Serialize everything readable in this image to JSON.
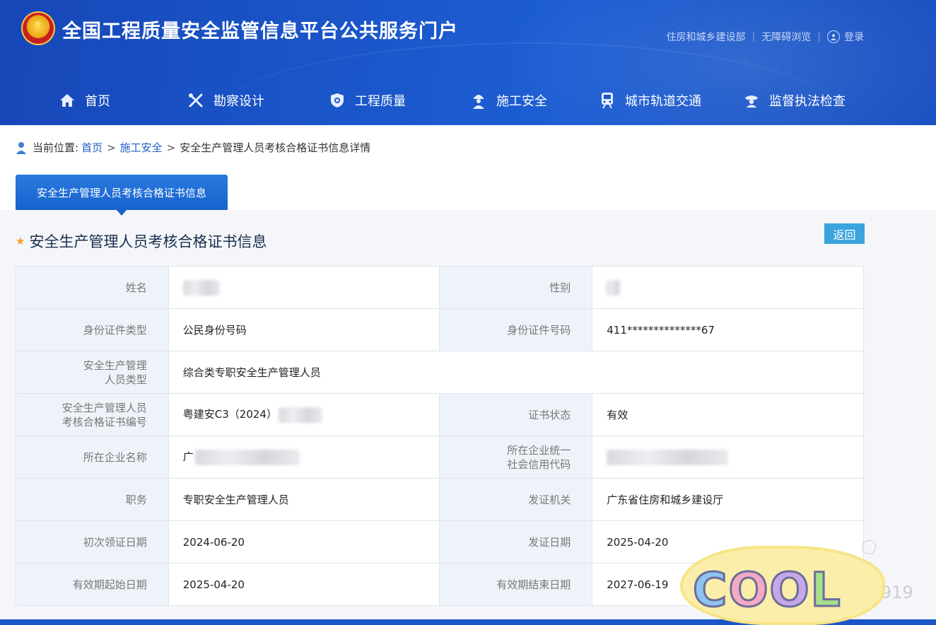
{
  "header": {
    "site_title": "全国工程质量安全监管信息平台公共服务门户",
    "links": [
      "住房和城乡建设部",
      "无障碍浏览"
    ],
    "login_label": "登录"
  },
  "nav": [
    {
      "label": "首页",
      "icon": "home-icon"
    },
    {
      "label": "勘察设计",
      "icon": "tools-icon"
    },
    {
      "label": "工程质量",
      "icon": "shield-icon"
    },
    {
      "label": "施工安全",
      "icon": "worker-icon"
    },
    {
      "label": "城市轨道交通",
      "icon": "train-icon"
    },
    {
      "label": "监督执法检查",
      "icon": "officer-icon"
    }
  ],
  "breadcrumb": {
    "prefix": "当前位置:",
    "home": "首页",
    "section": "施工安全",
    "current": "安全生产管理人员考核合格证书信息详情",
    "sep": ">"
  },
  "tab": {
    "label": "安全生产管理人员考核合格证书信息"
  },
  "section": {
    "title": "安全生产管理人员考核合格证书信息",
    "back_label": "返回"
  },
  "fields": {
    "name_label": "姓名",
    "gender_label": "性别",
    "id_type_label": "身份证件类型",
    "id_type_value": "公民身份号码",
    "id_no_label": "身份证件号码",
    "id_no_value": "411**************67",
    "person_type_label_1": "安全生产管理",
    "person_type_label_2": "人员类型",
    "person_type_value": "综合类专职安全生产管理人员",
    "cert_no_label_1": "安全生产管理人员",
    "cert_no_label_2": "考核合格证书编号",
    "cert_no_value": "粤建安C3（2024）",
    "status_label": "证书状态",
    "status_value": "有效",
    "company_label": "所在企业名称",
    "company_value": "广",
    "credit_code_label_1": "所在企业统一",
    "credit_code_label_2": "社会信用代码",
    "position_label": "职务",
    "position_value": "专职安全生产管理人员",
    "issuer_label": "发证机关",
    "issuer_value": "广东省住房和城乡建设厅",
    "first_issue_label": "初次领证日期",
    "first_issue_value": "2024-06-20",
    "issue_date_label": "发证日期",
    "issue_date_value": "2025-04-20",
    "valid_start_label": "有效期起始日期",
    "valid_start_value": "2025-04-20",
    "valid_end_label": "有效期结束日期",
    "valid_end_value": "2027-06-19"
  },
  "sticker": {
    "text": "COOL"
  },
  "watermark": {
    "digits": "919"
  },
  "colors": {
    "brand": "#1a55c8",
    "tab": "#1762cc",
    "back_button": "#3ba3df",
    "star": "#f0a020",
    "label_bg": "#eef3fa"
  }
}
